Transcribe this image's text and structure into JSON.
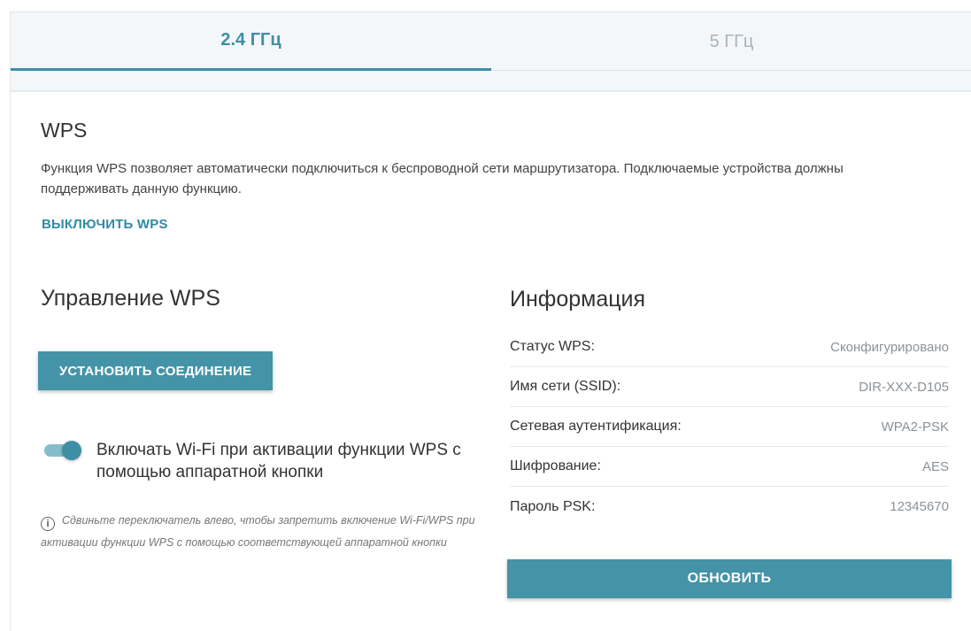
{
  "tabs": [
    {
      "label": "2.4 ГГц",
      "active": true
    },
    {
      "label": "5 ГГц",
      "active": false
    }
  ],
  "wps": {
    "title": "WPS",
    "description": "Функция WPS позволяет автоматически подключиться к беспроводной сети маршрутизатора. Подключаемые устройства должны поддерживать данную функцию.",
    "disable_link": "ВЫКЛЮЧИТЬ WPS"
  },
  "management": {
    "title": "Управление WPS",
    "connect_button": "УСТАНОВИТЬ СОЕДИНЕНИЕ",
    "toggle_enabled": true,
    "toggle_label": "Включать Wi-Fi при активации функции WPS с помощью аппаратной кнопки",
    "hint": "Сдвиньте переключатель влево, чтобы запретить включение Wi-Fi/WPS при активации функции WPS с помощью соответствующей аппаратной кнопки",
    "hint_icon": "info-icon"
  },
  "info": {
    "title": "Информация",
    "rows": [
      {
        "key": "Статус WPS:",
        "value": "Сконфигурировано"
      },
      {
        "key": "Имя сети (SSID):",
        "value": "DIR-XXX-D105"
      },
      {
        "key": "Сетевая аутентификация:",
        "value": "WPA2-PSK"
      },
      {
        "key": "Шифрование:",
        "value": "AES"
      },
      {
        "key": "Пароль PSK:",
        "value": "12345670"
      }
    ],
    "refresh_button": "ОБНОВИТЬ"
  },
  "colors": {
    "accent": "#3e8fa6",
    "button": "#4593a7",
    "tab_bg": "#f4f7f9"
  }
}
